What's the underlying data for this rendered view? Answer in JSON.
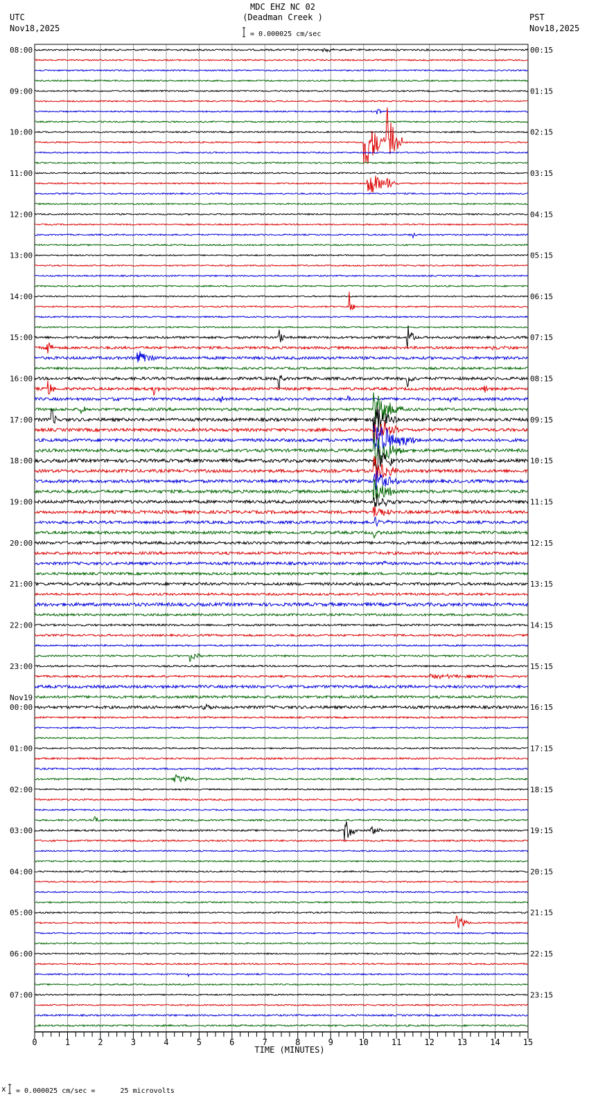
{
  "header": {
    "title": "MDC EHZ NC 02",
    "subtitle": "(Deadman Creek )",
    "left_tz": "UTC",
    "left_date": "Nov18,2025",
    "right_tz": "PST",
    "right_date": "Nov18,2025",
    "scale_text": "= 0.000025 cm/sec"
  },
  "footer": {
    "scale_text": "= 0.000025 cm/sec =      25 microvolts",
    "mark": "x"
  },
  "chart_data": {
    "type": "line",
    "subtype": "helicorder",
    "xlabel": "TIME (MINUTES)",
    "xlim": [
      0,
      15
    ],
    "x_ticks": [
      "0",
      "1",
      "2",
      "3",
      "4",
      "5",
      "6",
      "7",
      "8",
      "9",
      "10",
      "11",
      "12",
      "13",
      "14",
      "15"
    ],
    "minor_ticks_per_minute": 4,
    "rows_per_hour": 4,
    "row_count": 96,
    "trace_colors": [
      "#000000",
      "#dd0000",
      "#0000dd",
      "#006600"
    ],
    "grid": true,
    "left_labels": [
      "08:00",
      "09:00",
      "10:00",
      "11:00",
      "12:00",
      "13:00",
      "14:00",
      "15:00",
      "16:00",
      "17:00",
      "18:00",
      "19:00",
      "20:00",
      "21:00",
      "22:00",
      "23:00",
      "00:00",
      "01:00",
      "02:00",
      "03:00",
      "04:00",
      "05:00",
      "06:00",
      "07:00"
    ],
    "date_change_label": "Nov19",
    "date_change_hour_index": 16,
    "right_labels": [
      "00:15",
      "01:15",
      "02:15",
      "03:15",
      "04:15",
      "05:15",
      "06:15",
      "07:15",
      "08:15",
      "09:15",
      "10:15",
      "11:15",
      "12:15",
      "13:15",
      "14:15",
      "15:15",
      "16:15",
      "17:15",
      "18:15",
      "19:15",
      "20:15",
      "21:15",
      "22:15",
      "23:15"
    ],
    "noise_levels": [
      1.2,
      1,
      1,
      1,
      1,
      1,
      1,
      1,
      1,
      1,
      1,
      1,
      1,
      1,
      1,
      1,
      1,
      1,
      1,
      1,
      1,
      1,
      1,
      1,
      1,
      1,
      1,
      1,
      1.6,
      1.8,
      2,
      1.6,
      2,
      2,
      2,
      2,
      2.2,
      2.2,
      2.2,
      2.2,
      2.4,
      2.2,
      2.2,
      2.2,
      2.2,
      2.2,
      2,
      2,
      2,
      2,
      2,
      1.8,
      2,
      1.6,
      2.4,
      1.6,
      1.4,
      1.4,
      1.2,
      1.2,
      1.2,
      1.4,
      2,
      1.8,
      2,
      1.2,
      1,
      1,
      1,
      1.2,
      1.2,
      1.2,
      1,
      1.2,
      1,
      1.2,
      1.2,
      1.2,
      1,
      1,
      1,
      1,
      1,
      1,
      1,
      1,
      1,
      1,
      1,
      1,
      1,
      1,
      1,
      1,
      1.2,
      1.2
    ],
    "events": [
      {
        "row": 0,
        "minute": 8.7,
        "amp": 4,
        "dur": 0.6
      },
      {
        "row": 6,
        "minute": 10.4,
        "amp": 9,
        "dur": 0.2
      },
      {
        "row": 9,
        "minute": 10.0,
        "amp": 45,
        "dur": 0.8
      },
      {
        "row": 9,
        "minute": 10.7,
        "amp": 55,
        "dur": 0.5
      },
      {
        "row": 13,
        "minute": 10.1,
        "amp": 25,
        "dur": 0.8
      },
      {
        "row": 13,
        "minute": 10.7,
        "amp": 12,
        "dur": 0.4
      },
      {
        "row": 18,
        "minute": 11.5,
        "amp": 5,
        "dur": 0.2
      },
      {
        "row": 25,
        "minute": 9.55,
        "amp": 30,
        "dur": 0.2
      },
      {
        "row": 28,
        "minute": 7.4,
        "amp": 22,
        "dur": 0.2
      },
      {
        "row": 28,
        "minute": 11.3,
        "amp": 28,
        "dur": 0.3
      },
      {
        "row": 29,
        "minute": 0.35,
        "amp": 30,
        "dur": 0.2
      },
      {
        "row": 29,
        "minute": 13.9,
        "amp": 3,
        "dur": 1.1
      },
      {
        "row": 30,
        "minute": 3.1,
        "amp": 16,
        "dur": 0.6
      },
      {
        "row": 32,
        "minute": 7.4,
        "amp": 20,
        "dur": 0.2
      },
      {
        "row": 32,
        "minute": 11.3,
        "amp": 18,
        "dur": 0.3
      },
      {
        "row": 33,
        "minute": 0.4,
        "amp": 18,
        "dur": 0.2
      },
      {
        "row": 33,
        "minute": 3.6,
        "amp": 18,
        "dur": 0.2
      },
      {
        "row": 33,
        "minute": 13.6,
        "amp": 18,
        "dur": 0.2
      },
      {
        "row": 34,
        "minute": 2.4,
        "amp": 6,
        "dur": 0.2
      },
      {
        "row": 34,
        "minute": 5.6,
        "amp": 10,
        "dur": 0.2
      },
      {
        "row": 34,
        "minute": 9.5,
        "amp": 8,
        "dur": 0.2
      },
      {
        "row": 34,
        "minute": 12.6,
        "amp": 7,
        "dur": 0.2
      },
      {
        "row": 35,
        "minute": 1.4,
        "amp": 8,
        "dur": 0.3
      },
      {
        "row": 36,
        "minute": 0.5,
        "amp": 20,
        "dur": 0.2
      },
      {
        "row": 35,
        "minute": 10.3,
        "amp": 30,
        "dur": 0.9
      },
      {
        "row": 36,
        "minute": 10.3,
        "amp": 30,
        "dur": 0.8
      },
      {
        "row": 37,
        "minute": 10.3,
        "amp": 30,
        "dur": 0.8
      },
      {
        "row": 38,
        "minute": 10.3,
        "amp": 30,
        "dur": 1.3
      },
      {
        "row": 39,
        "minute": 10.3,
        "amp": 30,
        "dur": 1.0
      },
      {
        "row": 40,
        "minute": 10.3,
        "amp": 28,
        "dur": 0.8
      },
      {
        "row": 41,
        "minute": 10.3,
        "amp": 25,
        "dur": 0.8
      },
      {
        "row": 42,
        "minute": 10.3,
        "amp": 22,
        "dur": 0.8
      },
      {
        "row": 43,
        "minute": 10.3,
        "amp": 20,
        "dur": 0.8
      },
      {
        "row": 44,
        "minute": 10.3,
        "amp": 16,
        "dur": 0.7
      },
      {
        "row": 45,
        "minute": 10.3,
        "amp": 12,
        "dur": 0.6
      },
      {
        "row": 46,
        "minute": 10.3,
        "amp": 10,
        "dur": 0.5
      },
      {
        "row": 47,
        "minute": 10.3,
        "amp": 8,
        "dur": 0.4
      },
      {
        "row": 50,
        "minute": 10.6,
        "amp": 8,
        "dur": 0.2
      },
      {
        "row": 50,
        "minute": 14.5,
        "amp": 6,
        "dur": 0.2
      },
      {
        "row": 59,
        "minute": 4.7,
        "amp": 10,
        "dur": 0.4
      },
      {
        "row": 61,
        "minute": 12.0,
        "amp": 3,
        "dur": 3.0
      },
      {
        "row": 64,
        "minute": 5.1,
        "amp": 5,
        "dur": 0.5
      },
      {
        "row": 71,
        "minute": 4.2,
        "amp": 9,
        "dur": 0.8
      },
      {
        "row": 75,
        "minute": 1.8,
        "amp": 7,
        "dur": 0.3
      },
      {
        "row": 76,
        "minute": 9.4,
        "amp": 22,
        "dur": 0.4
      },
      {
        "row": 76,
        "minute": 10.2,
        "amp": 10,
        "dur": 0.4
      },
      {
        "row": 85,
        "minute": 12.8,
        "amp": 14,
        "dur": 0.5
      },
      {
        "row": 90,
        "minute": 4.6,
        "amp": 6,
        "dur": 0.2
      }
    ]
  }
}
